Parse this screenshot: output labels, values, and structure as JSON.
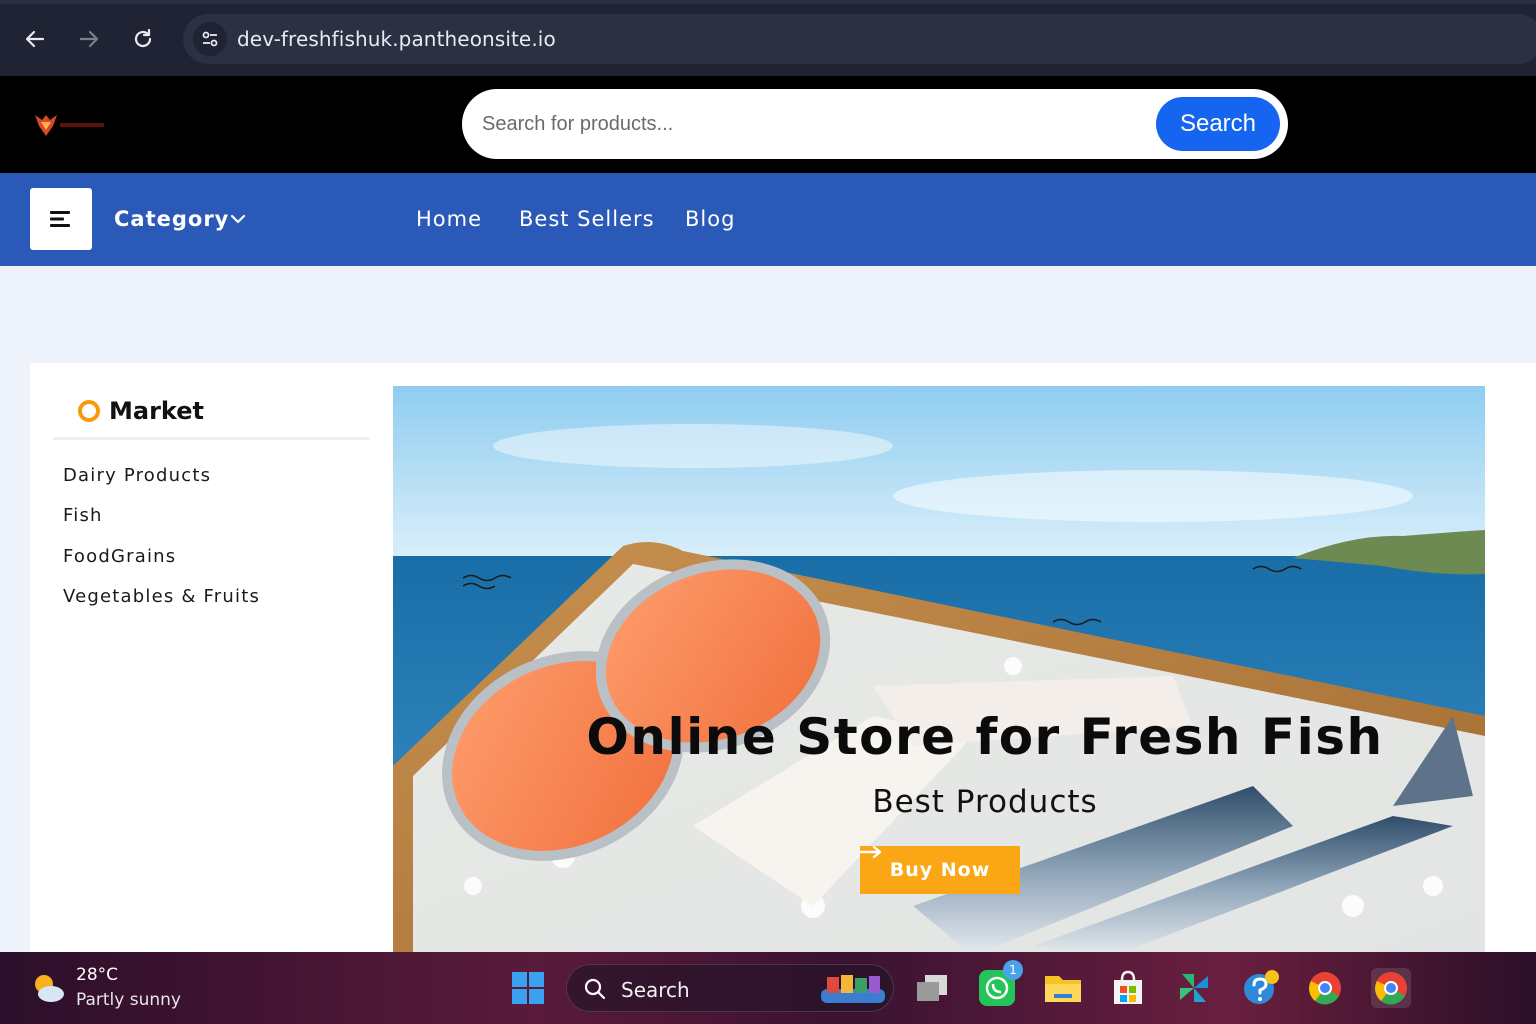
{
  "browser": {
    "url": "dev-freshfishuk.pantheonsite.io"
  },
  "header": {
    "logo_text": "FRESHFISHUK",
    "search_placeholder": "Search for products...",
    "search_button": "Search"
  },
  "nav": {
    "category_label": "Category",
    "links": [
      "Home",
      "Best Sellers",
      "Blog"
    ]
  },
  "sidebar": {
    "title": "Market",
    "items": [
      "Dairy Products",
      "Fish",
      "FoodGrains",
      "Vegetables & Fruits"
    ]
  },
  "hero": {
    "title": "Online Store for Fresh Fish",
    "subtitle": "Best Products",
    "button": "Buy Now"
  },
  "taskbar": {
    "temperature": "28°C",
    "condition": "Partly sunny",
    "search_label": "Search",
    "whatsapp_badge": "1"
  },
  "colors": {
    "nav_blue": "#2b59b8",
    "search_button": "#1565f0",
    "buy_button": "#fba614",
    "market_ring": "#f59a0c"
  }
}
